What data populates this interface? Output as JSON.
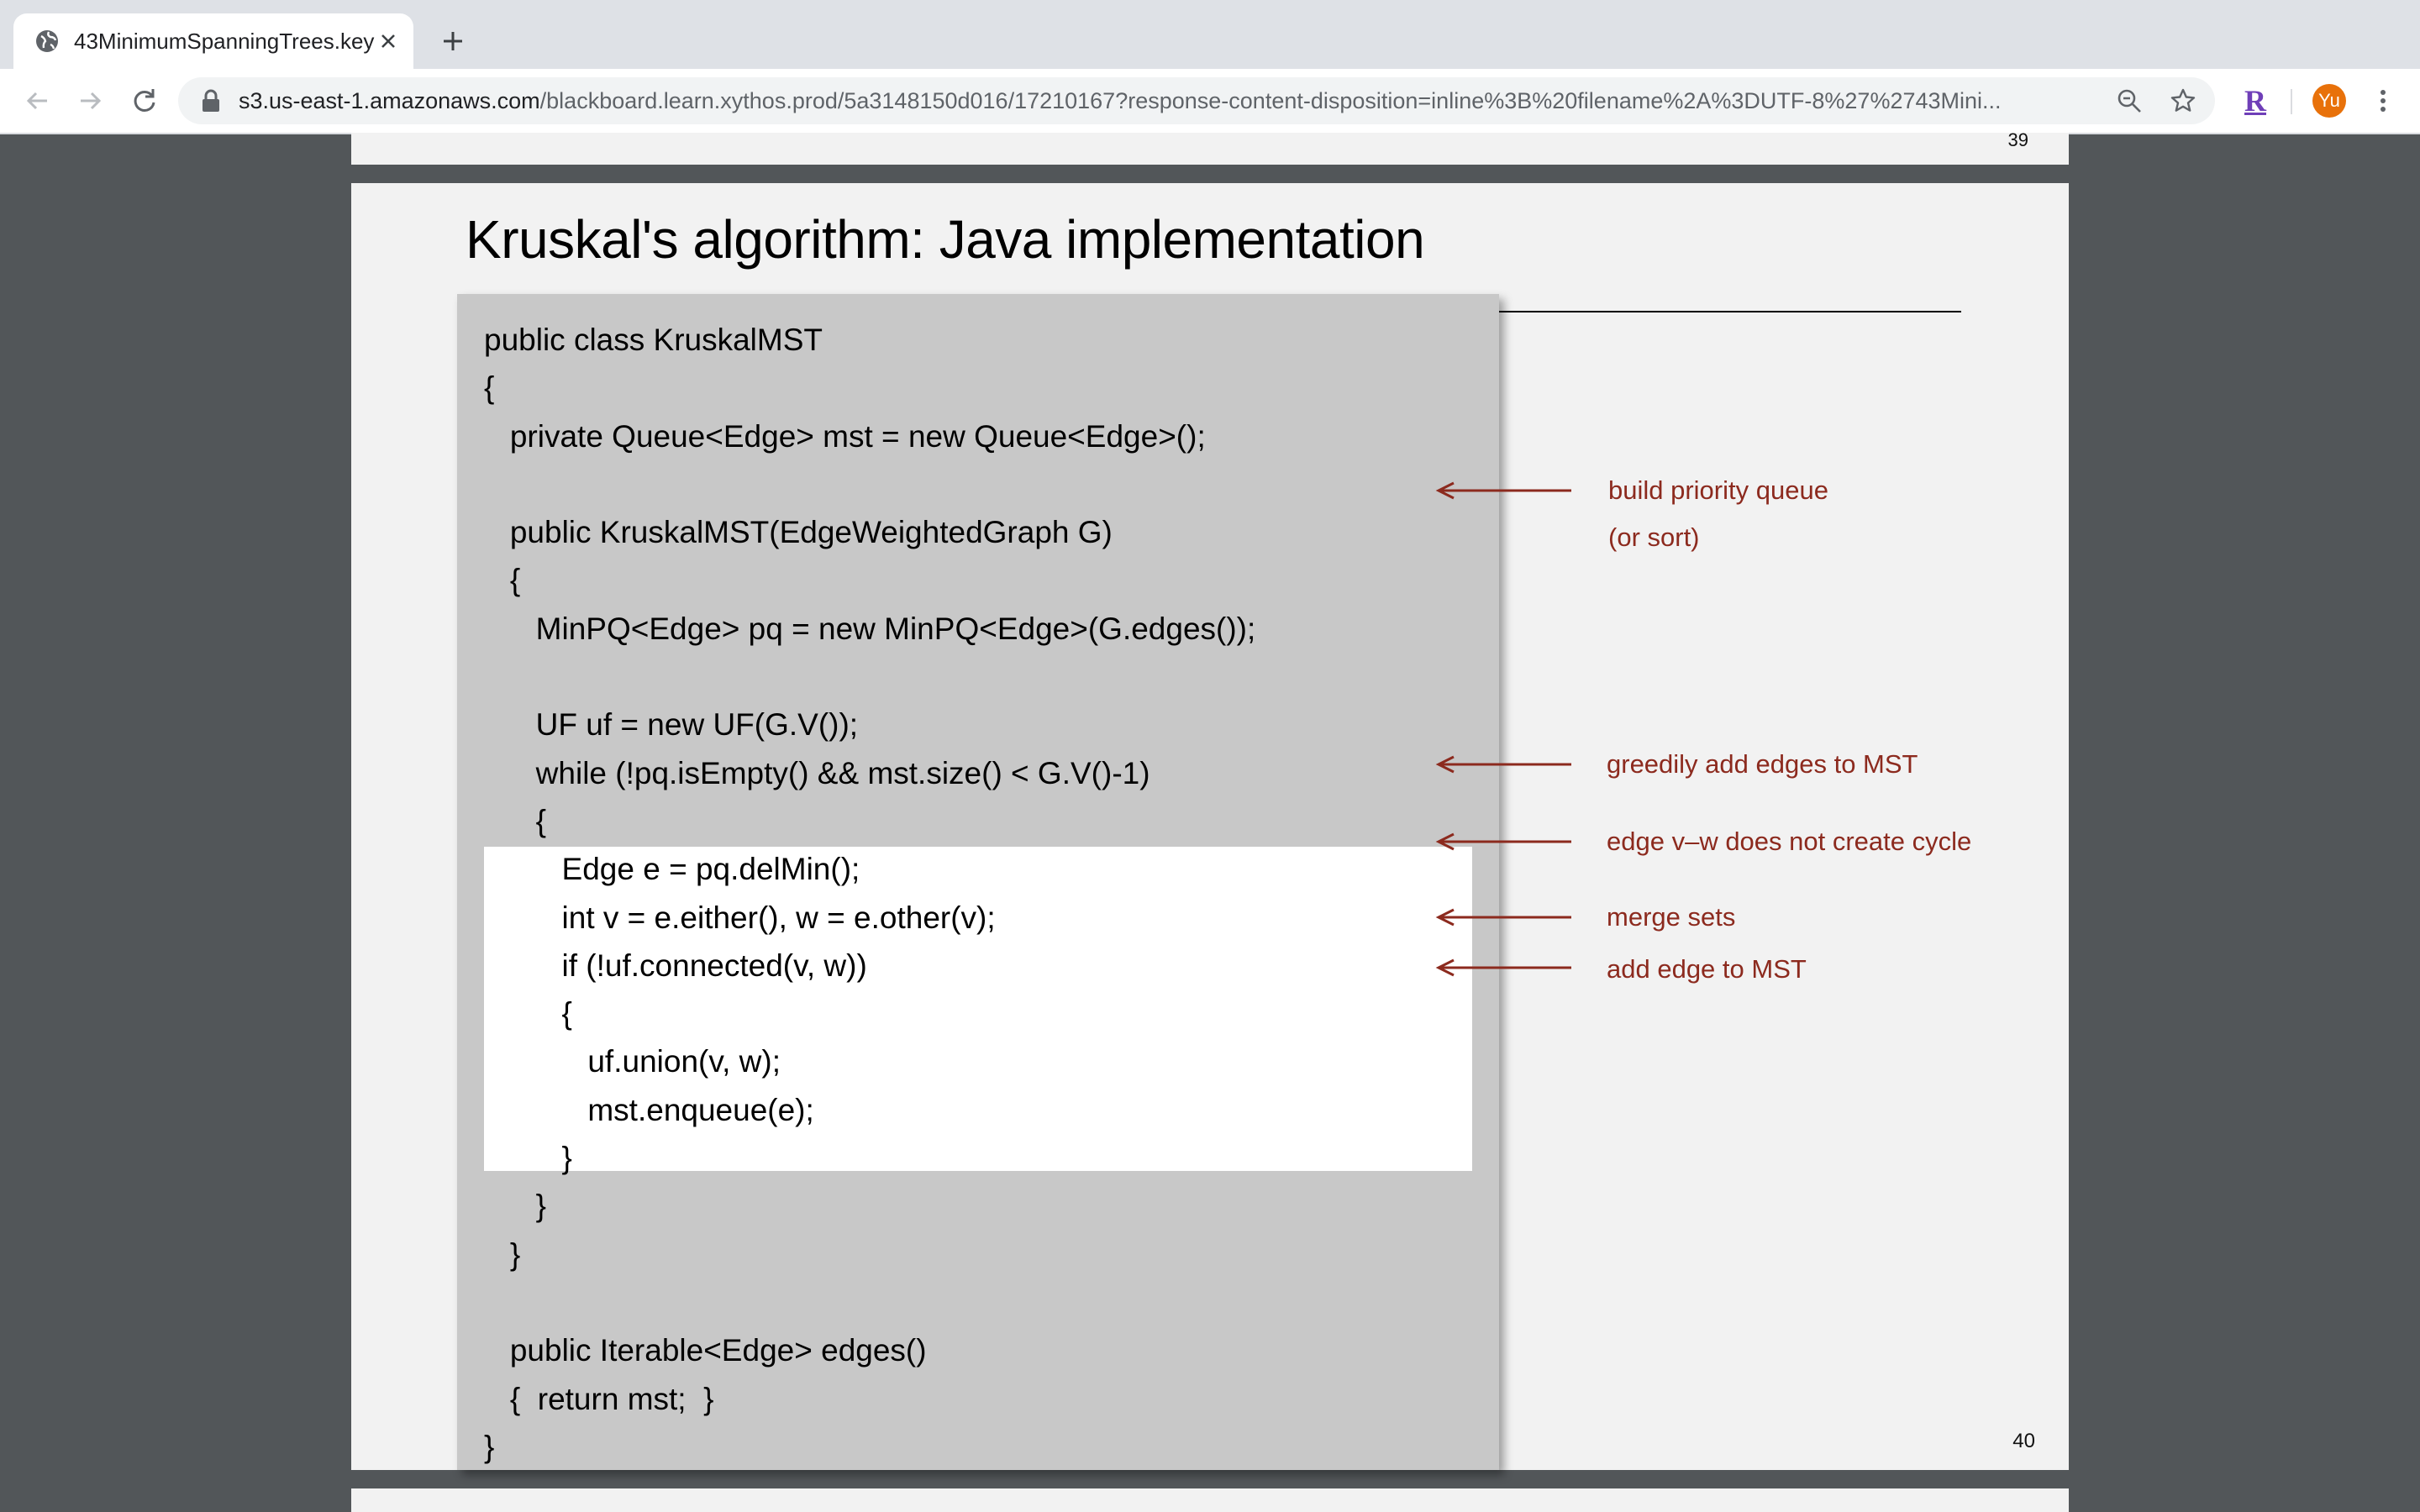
{
  "browser": {
    "tab": {
      "title": "43MinimumSpanningTrees.key"
    },
    "url": {
      "host": "s3.us-east-1.amazonaws.com",
      "path": "/blackboard.learn.xythos.prod/5a3148150d016/17210167?response-content-disposition=inline%3B%20filename%2A%3DUTF-8%27%2743Mini..."
    },
    "extension_label": "R",
    "avatar_initials": "Yu",
    "accent_color": "#e8710a"
  },
  "pdf": {
    "previous_page_number": "39",
    "slide": {
      "title": "Kruskal's algorithm:  Java implementation",
      "page_number": "40",
      "code_lines": [
        "public class KruskalMST",
        "{",
        "   private Queue<Edge> mst = new Queue<Edge>();",
        "",
        "   public KruskalMST(EdgeWeightedGraph G)",
        "   {",
        "      MinPQ<Edge> pq = new MinPQ<Edge>(G.edges());",
        "",
        "      UF uf = new UF(G.V());",
        "      while (!pq.isEmpty() && mst.size() < G.V()-1)",
        "      {",
        "         Edge e = pq.delMin();",
        "         int v = e.either(), w = e.other(v);",
        "         if (!uf.connected(v, w))",
        "         {",
        "            uf.union(v, w);",
        "            mst.enqueue(e);",
        "         }",
        "      }",
        "   }",
        "",
        "   public Iterable<Edge> edges()",
        "   {  return mst;  }",
        "}"
      ],
      "highlighted_lines": {
        "from": 11,
        "to": 17
      },
      "annotations": [
        {
          "id": "pq",
          "lines": [
            "build priority queue",
            "(or sort)"
          ]
        },
        {
          "id": "greedy",
          "lines": [
            "greedily add edges to MST"
          ]
        },
        {
          "id": "cycle",
          "lines": [
            "edge v–w does not create cycle"
          ]
        },
        {
          "id": "merge",
          "lines": [
            "merge sets"
          ]
        },
        {
          "id": "add",
          "lines": [
            "add edge to MST"
          ]
        }
      ],
      "annotation_color": "#8c2a1e"
    }
  }
}
